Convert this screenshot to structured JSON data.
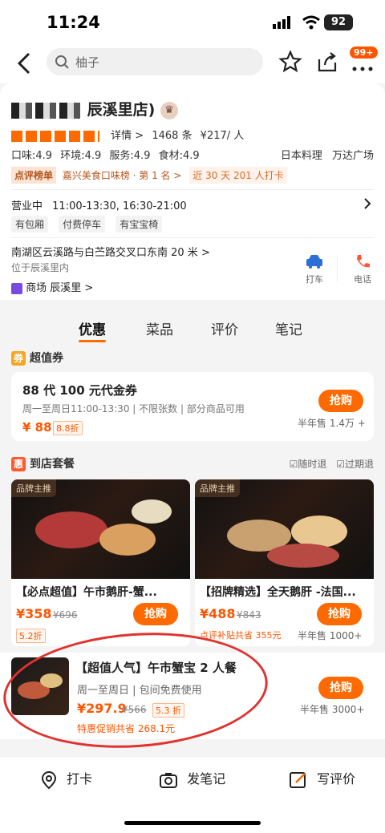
{
  "status": {
    "time": "11:24",
    "battery": "92"
  },
  "nav": {
    "search_placeholder": "柚子",
    "badge": "99+"
  },
  "shop": {
    "name": "辰溪里店)",
    "detail_label": "详情 >",
    "reviews": "1468 条",
    "price": "¥217/ 人",
    "scores": [
      "口味:4.9",
      "环境:4.9",
      "服务:4.9",
      "食材:4.9"
    ],
    "cuisine": "日本料理",
    "area": "万达广场",
    "rank_tag": "点评榜单",
    "rank_text": "嘉兴美食口味榜 · 第 1 名 >",
    "checkin_text": "近 30 天 201 人打卡",
    "hours_label": "营业中",
    "hours": "11:00-13:30, 16:30-21:00",
    "facilities": [
      "有包厢",
      "付费停车",
      "有宝宝椅"
    ],
    "address": "南湖区云溪路与白苎路交叉口东南 20 米 >",
    "address_sub": "位于辰溪里内",
    "mall_label": "商场",
    "mall_name": "辰溪里 >",
    "actions": {
      "taxi": "打车",
      "phone": "电话"
    }
  },
  "tabs": [
    "优惠",
    "菜品",
    "评价",
    "笔记"
  ],
  "voucher_section": {
    "icon": "券",
    "title": "超值券"
  },
  "voucher": {
    "title": "88 代 100 元代金券",
    "desc": "周一至周日11:00-13:30 | 不限张数 | 部分商品可用",
    "price": "¥ 88",
    "discount": "8.8折",
    "button": "抢购",
    "sold": "半年售 1.4万 +"
  },
  "package_section": {
    "icon": "惠",
    "title": "到店套餐",
    "refund": "随时退",
    "expire": "过期退"
  },
  "deals": [
    {
      "label": "品牌主推",
      "title": "【必点超值】午市鹅肝-蟹...",
      "price": "¥358",
      "orig": "¥696",
      "button": "抢购",
      "discount": "5.2折"
    },
    {
      "label": "品牌主推",
      "title": "【招牌精选】全天鹅肝 -法国...",
      "price": "¥488",
      "orig": "¥843",
      "button": "抢购",
      "subsidy": "点评补贴共省 355元",
      "sold": "半年售 1000+"
    }
  ],
  "package": {
    "title": "【超值人气】午市蟹宝 2 人餐",
    "desc": "周一至周日 | 包间免费使用",
    "price": "¥297.9",
    "orig": "¥566",
    "discount": "5.3 折",
    "saving": "特惠促销共省 268.1元",
    "button": "抢购",
    "sold": "半年售 3000+"
  },
  "bottom": {
    "checkin": "打卡",
    "note": "发笔记",
    "review": "写评价"
  },
  "colors": {
    "accent": "#ff6a00",
    "circle": "#e0322f"
  }
}
